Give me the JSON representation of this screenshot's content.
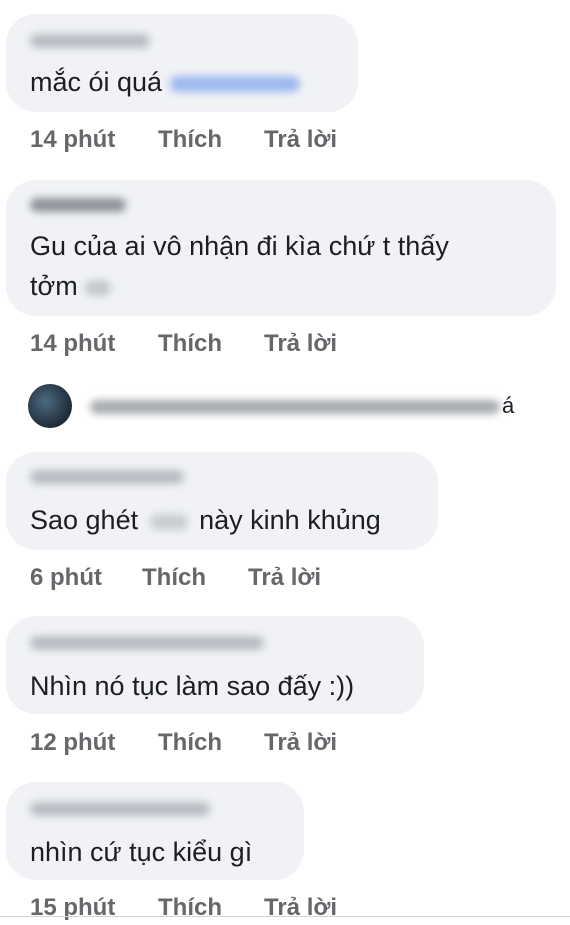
{
  "comments": [
    {
      "text": "mắc ói quá",
      "time": "14 phút",
      "like": "Thích",
      "reply": "Trả lời"
    },
    {
      "text_line1": "Gu của ai vô nhận đi kìa chứ t thấy",
      "text_line2": "tởm",
      "time": "14 phút",
      "like": "Thích",
      "reply": "Trả lời"
    },
    {
      "text_before": "Sao ghét",
      "text_after": "này kinh khủng",
      "time": "6 phút",
      "like": "Thích",
      "reply": "Trả lời"
    },
    {
      "text": "Nhìn nó tục làm sao đấy :))",
      "time": "12 phút",
      "like": "Thích",
      "reply": "Trả lời"
    },
    {
      "text": "nhìn cứ tục kiểu gì",
      "time": "15 phút",
      "like": "Thích",
      "reply": "Trả lời"
    }
  ],
  "reply_summary": {
    "trailing_text": "á"
  },
  "colors": {
    "bubble": "#f0f2f5",
    "meta_text": "#65676b",
    "text": "#1c1e21"
  }
}
